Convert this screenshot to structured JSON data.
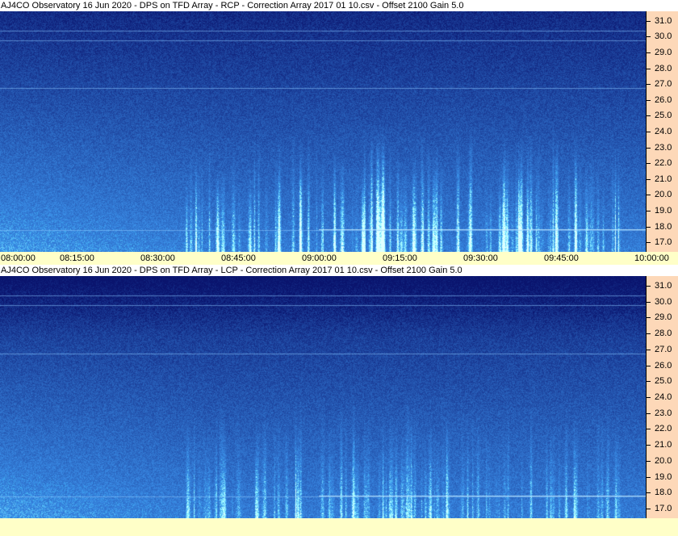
{
  "panels": [
    {
      "title": "AJ4CO Observatory 16 Jun 2020  -  DPS on TFD Array  -  RCP  -  Correction Array 2017 01 10.csv  -  Offset 2100  Gain 5.0",
      "polarization": "RCP"
    },
    {
      "title": "AJ4CO Observatory 16 Jun 2020  -  DPS on TFD Array  -  LCP  -  Correction Array 2017 01 10.csv  -  Offset 2100  Gain 5.0",
      "polarization": "LCP"
    }
  ],
  "chart_data": {
    "type": "heatmap",
    "description_units": "frequency (MHz) vs time",
    "y_ticks": [
      "17.0",
      "18.0",
      "19.0",
      "20.0",
      "21.0",
      "22.0",
      "23.0",
      "24.0",
      "25.0",
      "26.0",
      "27.0",
      "28.0",
      "29.0",
      "30.0",
      "31.0"
    ],
    "ylim": [
      16.4,
      31.6
    ],
    "x_ticks": [
      "08:00:00",
      "08:15:00",
      "08:30:00",
      "08:45:00",
      "09:00:00",
      "09:15:00",
      "09:30:00",
      "09:45:00",
      "10:00:00"
    ],
    "xlim": [
      "08:00:00",
      "10:00:00"
    ],
    "colors": {
      "background_deep": "#0b1a7a",
      "background_mid": "#1f48e0",
      "background_low": "#2e7cf0",
      "burst": "#a8e8ff",
      "axis_bg": "#fdd8b8",
      "xaxis_bg": "#ffffc8"
    }
  }
}
